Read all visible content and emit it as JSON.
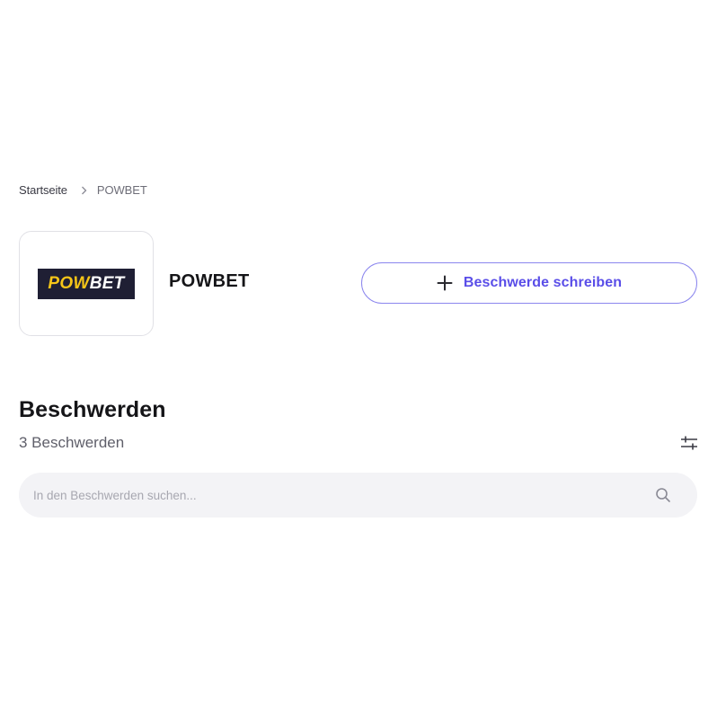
{
  "breadcrumb": {
    "home": "Startseite",
    "separator_icon": "chevron-right-icon",
    "current": "POWBET"
  },
  "brand": {
    "logo_text_accent": "POW",
    "logo_text_main": "BET",
    "name": "POWBET"
  },
  "actions": {
    "write_complaint_label": "Beschwerde schreiben",
    "write_complaint_icon": "plus-icon"
  },
  "complaints": {
    "title": "Beschwerden",
    "count_text": "3 Beschwerden",
    "filter_icon": "filter-sliders-icon"
  },
  "search": {
    "placeholder": "In den Beschwerden suchen...",
    "value": "",
    "icon": "search-icon"
  },
  "colors": {
    "accent": "#5a4ee8",
    "accent_border": "#8b86ee",
    "search_bg": "#f3f3f6",
    "logo_bg": "#1f1f34",
    "logo_yellow": "#f5c518"
  }
}
